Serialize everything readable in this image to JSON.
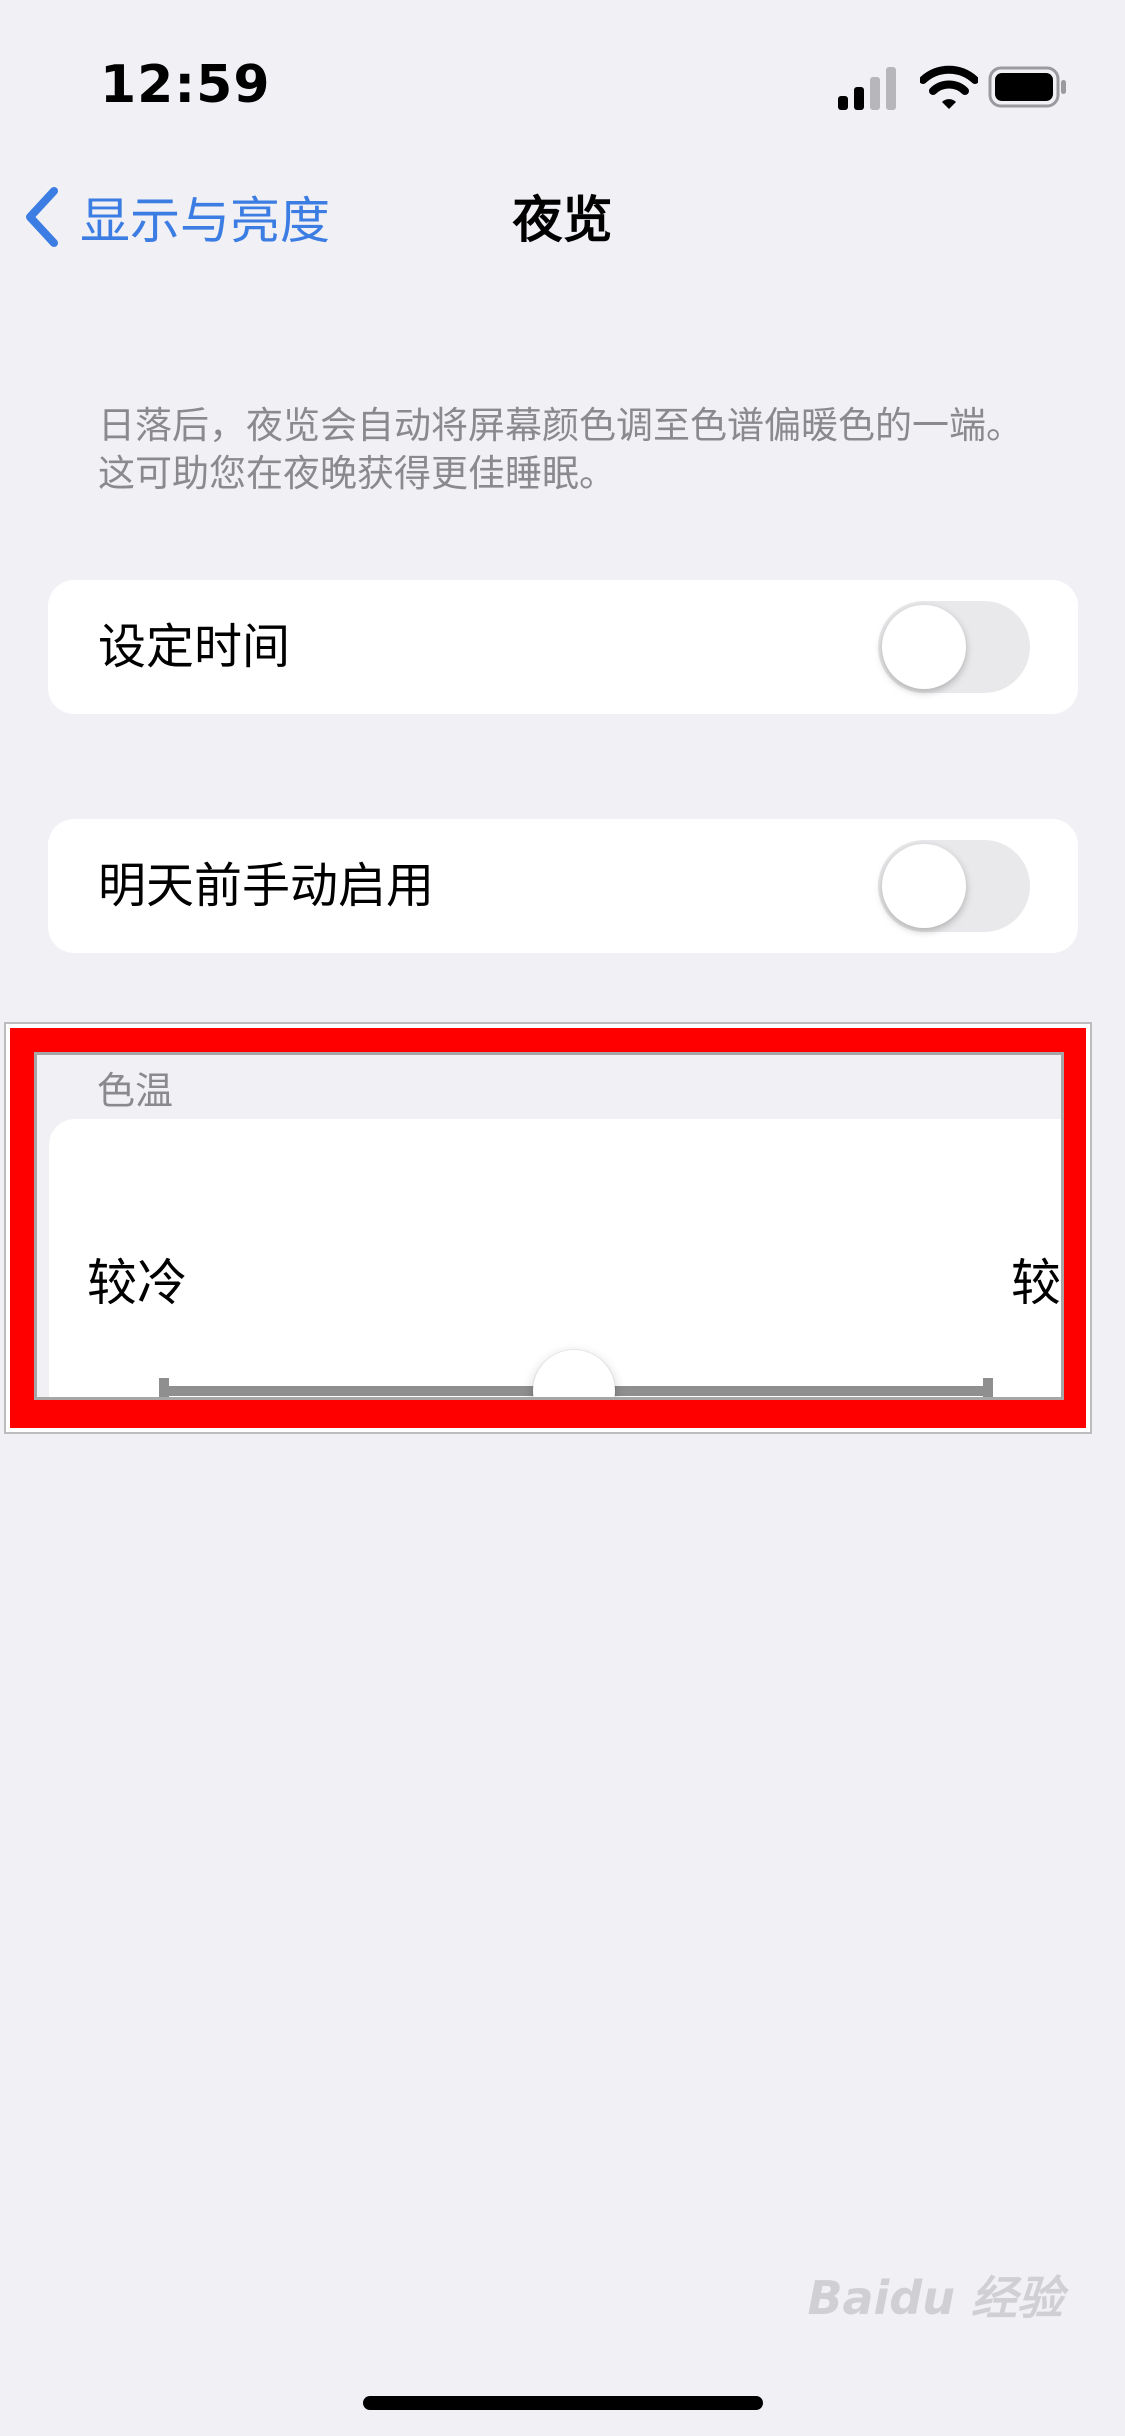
{
  "status_bar": {
    "time": "12:59"
  },
  "nav": {
    "back_label": "显示与亮度",
    "title": "夜览"
  },
  "description": "日落后，夜览会自动将屏幕颜色调至色谱偏暖色的一端。这可助您在夜晚获得更佳睡眠。",
  "settings": [
    {
      "label": "设定时间",
      "enabled": false
    },
    {
      "label": "明天前手动启用",
      "enabled": false
    }
  ],
  "color_temperature": {
    "header": "色温",
    "min_label": "较冷",
    "max_label": "较暖",
    "value": 0.5
  },
  "watermark": "Baidu 经验",
  "colors": {
    "accent": "#3b7de2",
    "highlight_frame": "#fe0000",
    "background": "#f0f0f5"
  }
}
